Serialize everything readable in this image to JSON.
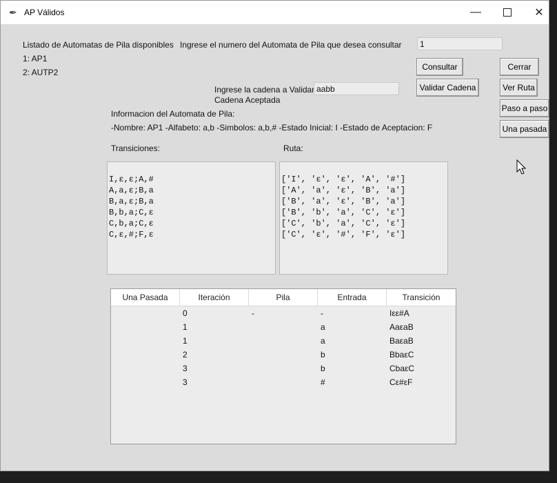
{
  "window": {
    "title": "AP Válidos"
  },
  "list": {
    "heading": "Listado de Automatas de Pila disponibles",
    "items": [
      "1: AP1",
      "2: AUTP2"
    ]
  },
  "prompt": {
    "label": "Ingrese el numero del Automata de Pila que desea consultar",
    "value": "1"
  },
  "cadena": {
    "label": "Ingrese la cadena a Validar",
    "value": "aabb",
    "status": "Cadena Aceptada"
  },
  "buttons": {
    "consultar": "Consultar",
    "validar": "Validar Cadena",
    "cerrar": "Cerrar",
    "ver_ruta": "Ver Ruta",
    "paso_a_paso": "Paso a paso",
    "una_pasada": "Una pasada"
  },
  "info": {
    "heading": "Informacion del Automata de Pila:",
    "detail": "-Nombre: AP1  -Alfabeto: a,b   -Simbolos: a,b,#   -Estado Inicial: I   -Estado de Aceptacion: F"
  },
  "transiciones": {
    "label": "Transiciones:",
    "lines": [
      "I,ε,ε;A,#",
      "A,a,ε;B,a",
      "B,a,ε;B,a",
      "B,b,a;C,ε",
      "C,b,a;C,ε",
      "C,ε,#;F,ε"
    ]
  },
  "ruta": {
    "label": "Ruta:",
    "lines": [
      "['I', 'ε', 'ε', 'A', '#']",
      "['A', 'a', 'ε', 'B', 'a']",
      "['B', 'a', 'ε', 'B', 'a']",
      "['B', 'b', 'a', 'C', 'ε']",
      "['C', 'b', 'a', 'C', 'ε']",
      "['C', 'ε', '#', 'F', 'ε']"
    ]
  },
  "table": {
    "headers": [
      "Una Pasada",
      "Iteración",
      "Pila",
      "Entrada",
      "Transición"
    ],
    "rows": [
      {
        "iteracion": "0",
        "pila": "-",
        "entrada": "-",
        "transicion": "Iεε#A"
      },
      {
        "iteracion": "1",
        "pila": "",
        "entrada": "a",
        "transicion": "AaεaB"
      },
      {
        "iteracion": "1",
        "pila": "",
        "entrada": "a",
        "transicion": "BaεaB"
      },
      {
        "iteracion": "2",
        "pila": "",
        "entrada": "b",
        "transicion": "BbaεC"
      },
      {
        "iteracion": "3",
        "pila": "",
        "entrada": "b",
        "transicion": "CbaεC"
      },
      {
        "iteracion": "3",
        "pila": "",
        "entrada": "#",
        "transicion": "Cε#εF"
      }
    ]
  }
}
